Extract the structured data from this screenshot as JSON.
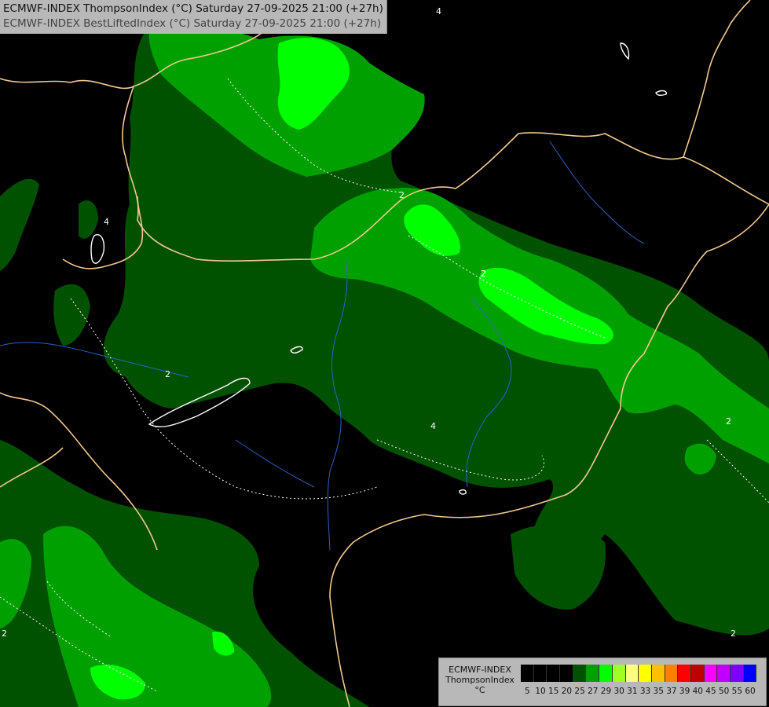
{
  "header": {
    "line1": "ECMWF-INDEX ThompsonIndex (°C) Saturday 27-09-2025 21:00 (+27h)",
    "line2": "ECMWF-INDEX BestLiftedIndex (°C) Saturday 27-09-2025 21:00 (+27h)"
  },
  "legend": {
    "model": "ECMWF-INDEX",
    "parameter": "ThompsonIndex",
    "unit": "°C",
    "classes": [
      {
        "value": "5",
        "color": "#000000"
      },
      {
        "value": "10",
        "color": "#000000"
      },
      {
        "value": "15",
        "color": "#000000"
      },
      {
        "value": "20",
        "color": "#000000"
      },
      {
        "value": "25",
        "color": "#005200"
      },
      {
        "value": "27",
        "color": "#00a000"
      },
      {
        "value": "29",
        "color": "#00ff00"
      },
      {
        "value": "30",
        "color": "#a0ff20"
      },
      {
        "value": "31",
        "color": "#ffff80"
      },
      {
        "value": "33",
        "color": "#ffff00"
      },
      {
        "value": "35",
        "color": "#ffc000"
      },
      {
        "value": "37",
        "color": "#ff8000"
      },
      {
        "value": "39",
        "color": "#ff0000"
      },
      {
        "value": "40",
        "color": "#c00000"
      },
      {
        "value": "45",
        "color": "#ff00ff"
      },
      {
        "value": "50",
        "color": "#c000ff"
      },
      {
        "value": "55",
        "color": "#8000ff"
      },
      {
        "value": "60",
        "color": "#0000ff"
      }
    ]
  },
  "map": {
    "colors": {
      "background": "#000000",
      "level_25": "#005200",
      "level_27": "#00a000",
      "level_29": "#00ff00",
      "borders": "#f0c890",
      "rivers": "#3060c0",
      "contours": "#ffffff"
    },
    "contour_labels": [
      "4",
      "2",
      "2",
      "4",
      "2",
      "2",
      "4",
      "2",
      "2"
    ]
  }
}
